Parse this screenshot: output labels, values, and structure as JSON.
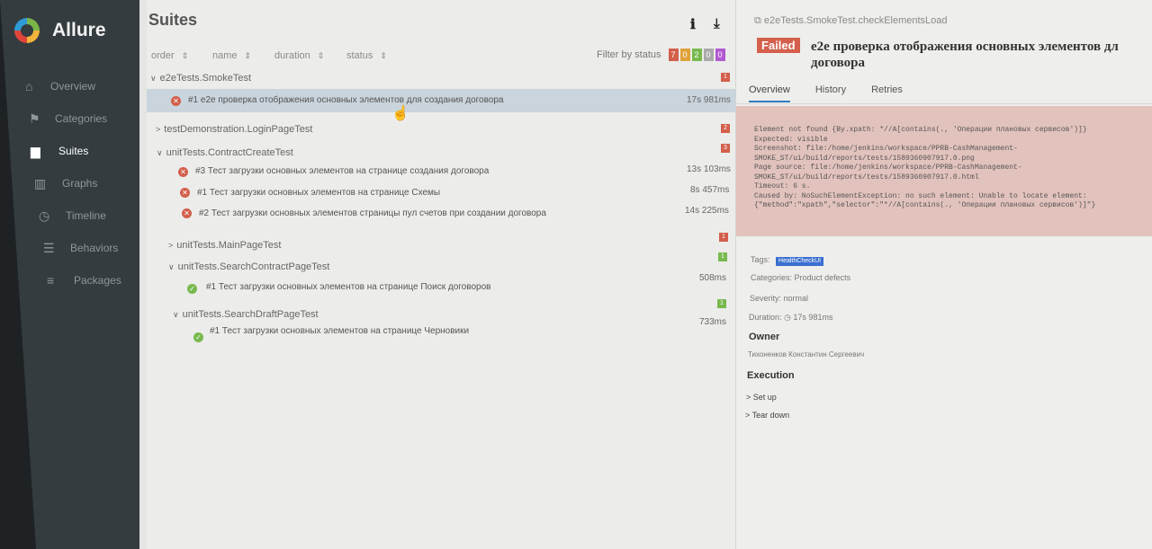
{
  "app": {
    "name": "Allure"
  },
  "sidebar": {
    "items": [
      {
        "label": "Overview",
        "icon": "home-icon"
      },
      {
        "label": "Categories",
        "icon": "flag-icon"
      },
      {
        "label": "Suites",
        "icon": "briefcase-icon",
        "active": true
      },
      {
        "label": "Graphs",
        "icon": "bar-chart-icon"
      },
      {
        "label": "Timeline",
        "icon": "clock-icon"
      },
      {
        "label": "Behaviors",
        "icon": "list-icon"
      },
      {
        "label": "Packages",
        "icon": "menu-icon"
      }
    ]
  },
  "suites": {
    "title": "Suites",
    "columns": [
      "order",
      "name",
      "duration",
      "status"
    ],
    "filter_label": "Filter by status",
    "filter_counts": [
      {
        "value": "7",
        "color": "#d35f4c"
      },
      {
        "value": "0",
        "color": "#e0a33a"
      },
      {
        "value": "2",
        "color": "#78b94e"
      },
      {
        "value": "0",
        "color": "#aaaaaa"
      },
      {
        "value": "0",
        "color": "#b05ad0"
      }
    ],
    "groups": [
      {
        "name": "e2eTests.SmokeTest",
        "badge": "1",
        "badge_color": "#d35f4c",
        "expanded": true
      },
      {
        "name": "testDemonstration.LoginPageTest",
        "badge": "2",
        "badge_color": "#d35f4c",
        "expanded": false
      },
      {
        "name": "unitTests.ContractCreateTest",
        "badge": "3",
        "badge_color": "#d35f4c",
        "expanded": true
      },
      {
        "name": "unitTests.MainPageTest",
        "badge": "1",
        "badge_color": "#d35f4c",
        "expanded": false
      },
      {
        "name": "unitTests.SearchContractPageTest",
        "badge": "1",
        "badge_color": "#78b94e",
        "expanded": true
      },
      {
        "name": "unitTests.SearchDraftPageTest",
        "badge": "1",
        "badge_color": "#78b94e",
        "expanded": true
      }
    ],
    "tests": [
      {
        "status": "failed",
        "title": "#1  e2e проверка отображения основных элементов для создания договора",
        "duration": "17s 981ms"
      },
      {
        "status": "failed",
        "title": "#3  Тест загрузки основных элементов на странице создания договора",
        "duration": "13s 103ms"
      },
      {
        "status": "failed",
        "title": "#1  Тест загрузки основных элементов на странице Схемы",
        "duration": "8s 457ms"
      },
      {
        "status": "failed",
        "title": "#2  Тест загрузки основных элементов страницы пул счетов при создании договора",
        "duration": "14s 225ms"
      },
      {
        "status": "passed",
        "title": "#1  Тест загрузки основных элементов на странице Поиск договоров",
        "duration": "508ms"
      },
      {
        "status": "passed",
        "title": "#1  Тест загрузки основных элементов на странице Черновики",
        "duration": "733ms"
      }
    ]
  },
  "detail": {
    "path": "e2eTests.SmokeTest.checkElementsLoad",
    "status": "Failed",
    "title_line1": "e2e проверка отображения основных элементов дл",
    "title_line2": "договора",
    "tabs": [
      "Overview",
      "History",
      "Retries"
    ],
    "error_lines": [
      "Element not found {By.xpath: *//A[contains(., 'Операции плановых сервисов')]}",
      "Expected: visible",
      "Screenshot: file:/home/jenkins/workspace/PPRB-CashManagement-",
      "SMOKE_ST/ui/build/reports/tests/1589360907917.0.png",
      "Page source: file:/home/jenkins/workspace/PPRB-CashManagement-",
      "SMOKE_ST/ui/build/reports/tests/1589360907917.0.html",
      "Timeout: 6 s.",
      "Caused by: NoSuchElementException: no such element: Unable to locate element:",
      "{\"method\":\"xpath\",\"selector\":\"*//A[contains(., 'Операции плановых сервисов')]\"}"
    ],
    "tags_label": "Tags:",
    "tag": "HealthCheckUI",
    "categories_label": "Categories:",
    "categories_value": "Product defects",
    "severity_label": "Severity:",
    "severity_value": "normal",
    "duration_label": "Duration:",
    "duration_value": "17s 981ms",
    "owner_heading": "Owner",
    "owner_name": "Тихоненков Константин Сергеевич",
    "execution_heading": "Execution",
    "execution_items": [
      "Set up",
      "Tear down"
    ]
  }
}
